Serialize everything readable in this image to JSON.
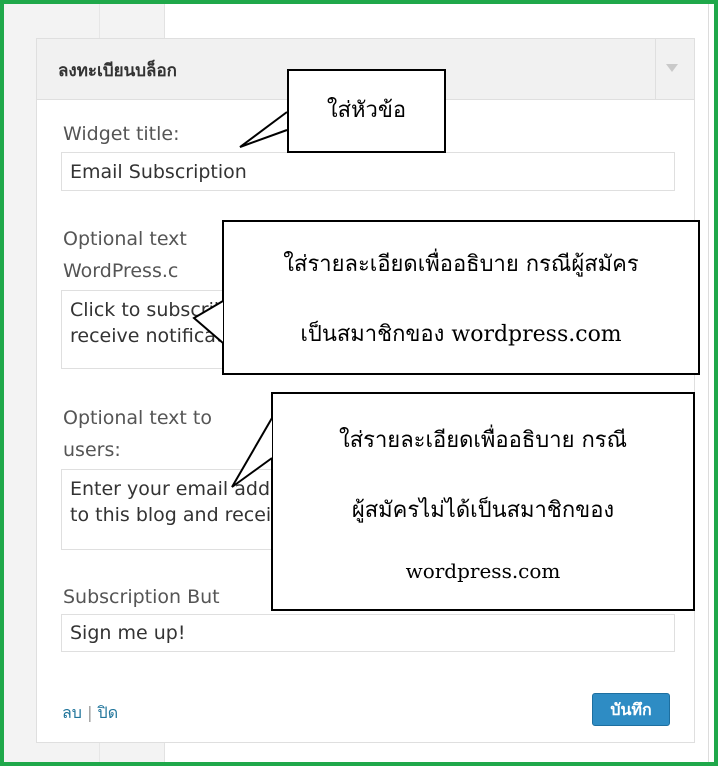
{
  "widget": {
    "title": "ลงทะเบียนบล็อก",
    "fields": {
      "widget_title": {
        "label": "Widget title:",
        "value": "Email Subscription"
      },
      "optional_wp": {
        "label_line1": "Optional text",
        "label_line2": "WordPress.c",
        "value": "Click to subscribe to this blog and\nreceive notifications of new posts by email."
      },
      "optional_other": {
        "label_line1": "Optional text to",
        "label_line2": "users:",
        "value": "Enter your email address to subscribe\nto this blog and receive notifications."
      },
      "button_label_field": {
        "label": "Subscription But",
        "value": "Sign me up!"
      }
    },
    "footer": {
      "delete": "ลบ",
      "separator": "|",
      "close": "ปิด"
    },
    "save_button": "บันทึก",
    "colors": {
      "frame_border": "#1fa84a",
      "save_button": "#2e8cc4",
      "link": "#21759b"
    }
  },
  "callouts": {
    "title_hint": "ใส่หัวข้อ",
    "wp_hint_line1": "ใส่รายละเอียดเพื่ออธิบาย กรณีผู้สมัคร",
    "wp_hint_line2": "เป็นสมาชิกของ wordpress.com",
    "other_hint_line1": "ใส่รายละเอียดเพื่ออธิบาย กรณี",
    "other_hint_line2": "ผู้สมัครไม่ได้เป็นสมาชิกของ",
    "other_hint_line3": "wordpress.com"
  }
}
